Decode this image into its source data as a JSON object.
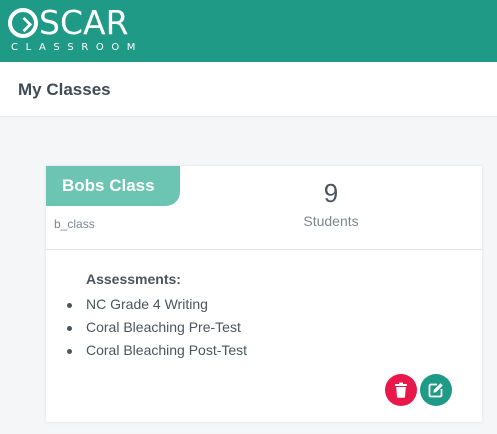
{
  "brand": {
    "name": "SCAR",
    "subtitle": "CLASSROOM"
  },
  "header": {
    "title": "My Classes"
  },
  "class_card": {
    "name": "Bobs Class",
    "code": "b_class",
    "student_count": "9",
    "student_label": "Students",
    "assessments_title": "Assessments:",
    "assessments": [
      "NC Grade 4 Writing",
      "Coral Bleaching Pre-Test",
      "Coral Bleaching Post-Test"
    ]
  },
  "colors": {
    "brand": "#1f9a86",
    "tab": "#6cc4b3",
    "delete": "#e8184a",
    "edit": "#1f9a86"
  },
  "icons": {
    "delete": "trash-icon",
    "edit": "edit-icon"
  }
}
